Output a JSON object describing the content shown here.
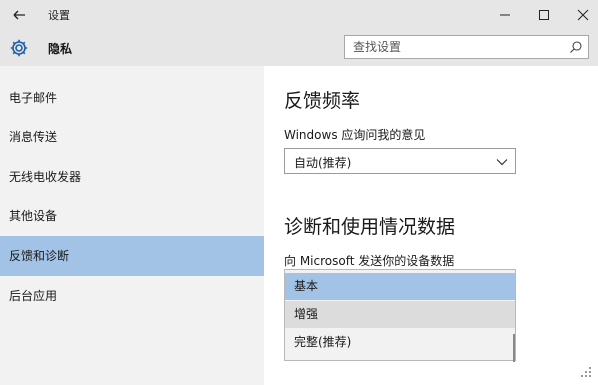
{
  "window": {
    "title": "设置",
    "back_icon": "back-arrow-icon",
    "controls": [
      "minimize-icon",
      "maximize-icon",
      "close-icon"
    ]
  },
  "header": {
    "icon": "gear-icon",
    "title": "隐私",
    "search_placeholder": "查找设置",
    "search_icon": "search-icon"
  },
  "sidebar": {
    "items": [
      {
        "label": "电子邮件",
        "active": false
      },
      {
        "label": "消息传送",
        "active": false
      },
      {
        "label": "无线电收发器",
        "active": false
      },
      {
        "label": "其他设备",
        "active": false
      },
      {
        "label": "反馈和诊断",
        "active": true
      },
      {
        "label": "后台应用",
        "active": false
      }
    ]
  },
  "main": {
    "feedback": {
      "heading": "反馈频率",
      "label": "Windows 应询问我的意见",
      "select_value": "自动(推荐)"
    },
    "diagnostics": {
      "heading": "诊断和使用情况数据",
      "label": "向 Microsoft 发送你的设备数据",
      "options": [
        "基本",
        "增强",
        "完整(推荐)"
      ],
      "selected_option": "基本",
      "hovered_option": "增强"
    }
  },
  "colors": {
    "chrome": "#e6e6e6",
    "sidebar_bg": "#f2f2f2",
    "accent_selected": "#a3c3e6",
    "hover": "#dcdcdc"
  }
}
